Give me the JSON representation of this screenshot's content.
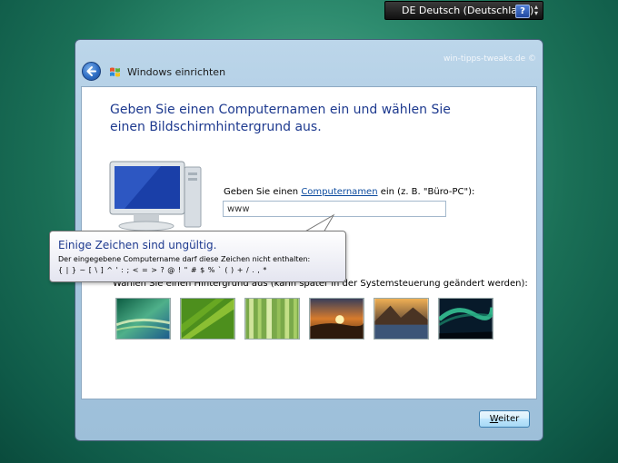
{
  "language_bar": {
    "label": "DE Deutsch (Deutschland)",
    "help_label": "?"
  },
  "window": {
    "title": "Windows einrichten",
    "watermark": "win-tipps-tweaks.de ©",
    "heading": "Geben Sie einen Computernamen ein und wählen Sie einen Bildschirmhintergrund aus."
  },
  "computer_name": {
    "label_prefix": "Geben Sie einen ",
    "label_link": "Computernamen",
    "label_suffix": " ein (z. B. \"Büro-PC\"):",
    "value": "www"
  },
  "background": {
    "label": "Wählen Sie einen Hintergrund aus (kann später in der Systemsteuerung geändert werden):",
    "thumbnails": [
      "vista-aurora",
      "green-leaf",
      "bamboo",
      "sunset-hills",
      "lake-rocks",
      "northern-lights"
    ]
  },
  "balloon": {
    "title": "Einige Zeichen sind ungültig.",
    "message": "Der eingegebene Computername darf diese Zeichen nicht enthalten:",
    "chars": "{ | } ~ [ \\ ] ^ ' : ; < = > ? @ ! \" # $ % ` ( ) + / . , *"
  },
  "buttons": {
    "next_underlined": "W",
    "next_rest": "eiter"
  },
  "colors": {
    "heading": "#1e3a8f",
    "link": "#0b4a9e",
    "desktop": "#2e8c6f"
  }
}
